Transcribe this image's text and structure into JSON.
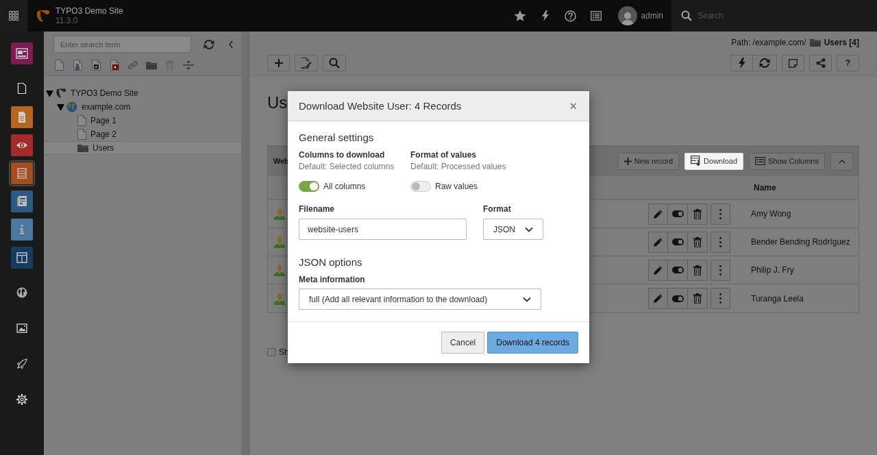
{
  "topbar": {
    "site_name": "TYPO3 Demo Site",
    "version": "11.3.0",
    "user": "admin",
    "search_placeholder": "Search"
  },
  "module_menu": [
    {
      "kind": "tile",
      "color": "#7d1b52",
      "selected": false
    },
    {
      "kind": "plain",
      "selected": false
    },
    {
      "kind": "tile",
      "color": "#b5661f",
      "selected": false
    },
    {
      "kind": "tile",
      "color": "#a32a2a",
      "selected": false
    },
    {
      "kind": "tile",
      "color": "#a24e1e",
      "selected": true
    },
    {
      "kind": "tile",
      "color": "#2d5a85",
      "selected": false
    },
    {
      "kind": "tile",
      "color": "#4c78a0",
      "selected": false
    },
    {
      "kind": "tile",
      "color": "#153d63",
      "selected": false
    },
    {
      "kind": "plain",
      "selected": false
    },
    {
      "kind": "plain",
      "selected": false
    },
    {
      "kind": "plain",
      "selected": false
    },
    {
      "kind": "plain",
      "selected": false
    }
  ],
  "page_tree": {
    "search_placeholder": "Enter search term",
    "nodes": [
      {
        "label": "TYPO3 Demo Site",
        "kind": "root",
        "expanded": true,
        "selected": false,
        "children": [
          {
            "label": "example.com",
            "kind": "site",
            "expanded": true,
            "selected": false,
            "children": [
              {
                "label": "Page 1",
                "kind": "page",
                "selected": false
              },
              {
                "label": "Page 2",
                "kind": "page",
                "selected": false
              },
              {
                "label": "Users",
                "kind": "folder",
                "selected": true
              }
            ]
          }
        ]
      }
    ]
  },
  "content": {
    "path_label": "Path: /example.com/",
    "path_page": "Users [4]",
    "help_label": "?",
    "heading": "Us",
    "table": {
      "title": "Web",
      "buttons": [
        {
          "label": "New record",
          "kind": "new",
          "highlighted": false
        },
        {
          "label": "Download",
          "kind": "download",
          "highlighted": true
        },
        {
          "label": "Show Columns",
          "kind": "columns",
          "highlighted": false
        }
      ],
      "columns": [
        "Name"
      ],
      "rows": [
        {
          "name": "Amy Wong"
        },
        {
          "name": "Bender Bending Rodríguez"
        },
        {
          "name": "Philip J. Fry"
        },
        {
          "name": "Turanga Leela"
        }
      ]
    },
    "checkbox": {
      "label": "Sh",
      "checked": false
    }
  },
  "modal": {
    "title": "Download Website User: 4 Records",
    "close_label": "×",
    "general_heading": "General settings",
    "options": [
      {
        "label": "Columns to download",
        "hint": "Default: Selected columns",
        "toggle_label": "All columns",
        "on": true
      },
      {
        "label": "Format of values",
        "hint": "Default: Processed values",
        "toggle_label": "Raw values",
        "on": false
      }
    ],
    "filename_label": "Filename",
    "filename": "website-users",
    "format_label": "Format",
    "format": "JSON",
    "json_heading": "JSON options",
    "meta_label": "Meta information",
    "meta": "full (Add all relevant information to the download)",
    "buttons": [
      {
        "label": "Cancel",
        "kind": "default"
      },
      {
        "label": "Download 4 records",
        "kind": "primary"
      }
    ]
  }
}
